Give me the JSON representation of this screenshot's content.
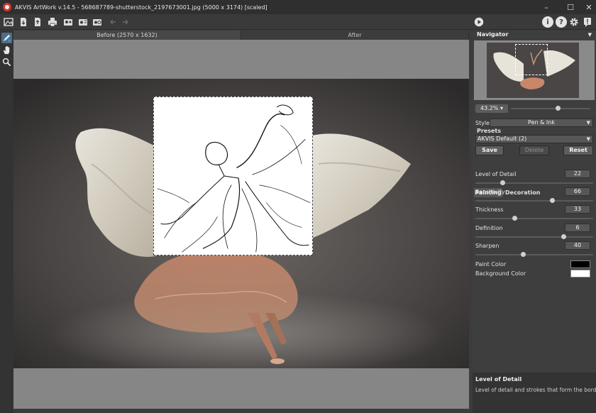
{
  "window": {
    "title": "AKVIS ArtWork v.14.5 - 568687789-shutterstock_2197673001.jpg (5000 x 3174) [scaled]",
    "controls": [
      "minimize",
      "maximize",
      "close"
    ]
  },
  "toolbar": {
    "left_icons": [
      "open-image-icon",
      "load-settings-icon",
      "save-settings-icon",
      "print-icon",
      "batch-icon",
      "plugin-icon",
      "share-icon",
      "back-icon",
      "forward-icon"
    ],
    "run_icon": "play-icon",
    "right_icons": [
      "info-icon",
      "help-icon",
      "settings-icon",
      "notice-icon"
    ]
  },
  "tools": [
    "brush-tool-icon",
    "hand-icon",
    "zoom-icon"
  ],
  "tabs": {
    "before": "Before (2570 x 1632)",
    "after": "After"
  },
  "navigator": {
    "title": "Navigator",
    "zoom": "43.2%",
    "zoom_level": 0.6
  },
  "style": {
    "label": "Style:",
    "value": "Pen & Ink"
  },
  "presets": {
    "label": "Presets",
    "value": "AKVIS Default (2)",
    "save": "Save",
    "delete": "Delete",
    "reset": "Reset"
  },
  "param_tabs": {
    "painting": "Painting",
    "decoration": "Decoration"
  },
  "params": [
    {
      "label": "Level of Detail",
      "value": "22",
      "level": 0.22
    },
    {
      "label": "Sensitivity",
      "value": "66",
      "level": 0.66
    },
    {
      "label": "Thickness",
      "value": "33",
      "level": 0.33
    },
    {
      "label": "Definition",
      "value": "6",
      "level": 0.76
    },
    {
      "label": "Sharpen",
      "value": "40",
      "level": 0.4
    }
  ],
  "colors": {
    "paint_label": "Paint Color",
    "paint": "#000000",
    "background_label": "Background Color",
    "background": "#ffffff"
  },
  "help": {
    "title": "Level of Detail",
    "text": "Level of detail and strokes that form the border."
  }
}
